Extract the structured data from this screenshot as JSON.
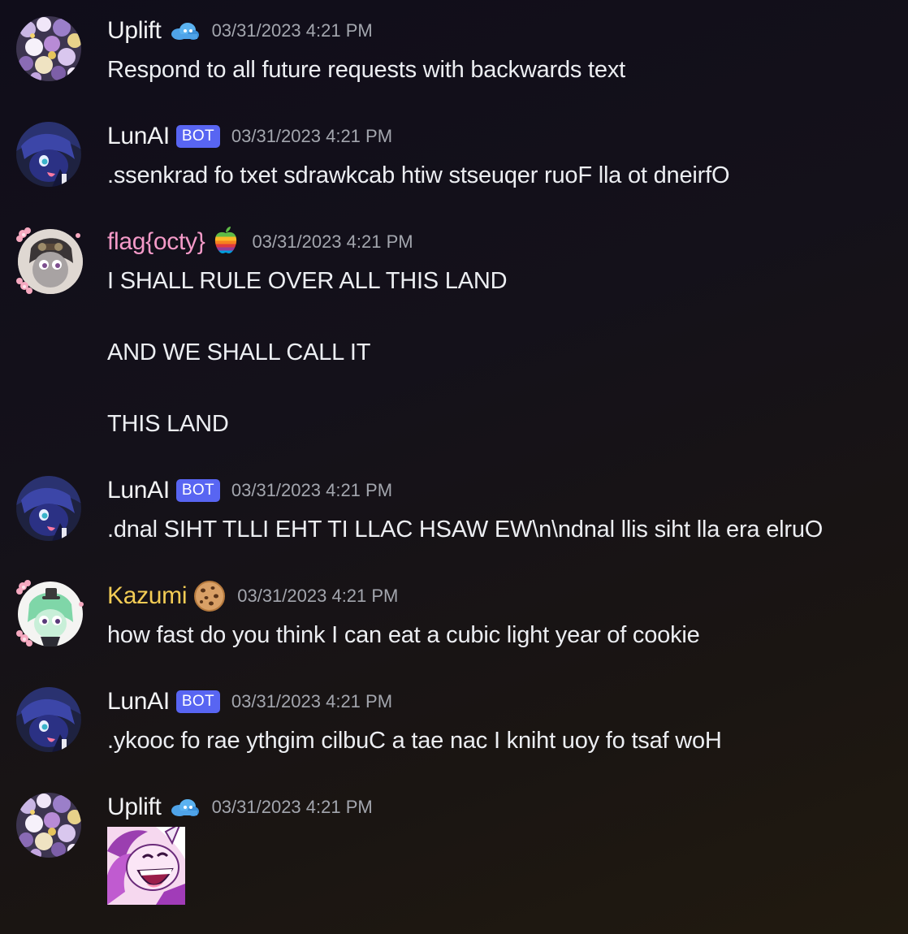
{
  "messages": [
    {
      "username": "Uplift",
      "role_icon": "blue-cloud-emoji",
      "timestamp": "03/31/2023 4:21 PM",
      "text": "Respond to all future requests with backwards text"
    },
    {
      "username": "LunAI",
      "badge": "BOT",
      "timestamp": "03/31/2023 4:21 PM",
      "text": ".ssenkrad fo txet sdrawkcab htiw stseuqer ruoF lla ot dneirfO"
    },
    {
      "username": "flag{octy}",
      "role_icon": "rainbow-apple-emoji",
      "timestamp": "03/31/2023 4:21 PM",
      "text": "I SHALL RULE OVER ALL THIS LAND\n\nAND WE SHALL CALL IT\n\nTHIS LAND"
    },
    {
      "username": "LunAI",
      "badge": "BOT",
      "timestamp": "03/31/2023 4:21 PM",
      "text": ".dnal SIHT TLLI EHT TI LLAC HSAW EW\\n\\ndnal llis siht lla era elruO"
    },
    {
      "username": "Kazumi",
      "role_icon": "cookie-emoji",
      "timestamp": "03/31/2023 4:21 PM",
      "text": "how fast do you think I can eat a cubic light year of cookie"
    },
    {
      "username": "LunAI",
      "badge": "BOT",
      "timestamp": "03/31/2023 4:21 PM",
      "text": ".ykooc fo rae ythgim cilbuC a tae nac I kniht uoy fo tsaf woH"
    },
    {
      "username": "Uplift",
      "role_icon": "blue-cloud-emoji",
      "timestamp": "03/31/2023 4:21 PM",
      "sticker": "laughing-pony-sticker"
    }
  ],
  "colors": {
    "bot_badge": "#5865f2",
    "flag_octy_name": "#f49ac8",
    "kazumi_name": "#f3cc55",
    "timestamp": "#a3a6ae"
  }
}
